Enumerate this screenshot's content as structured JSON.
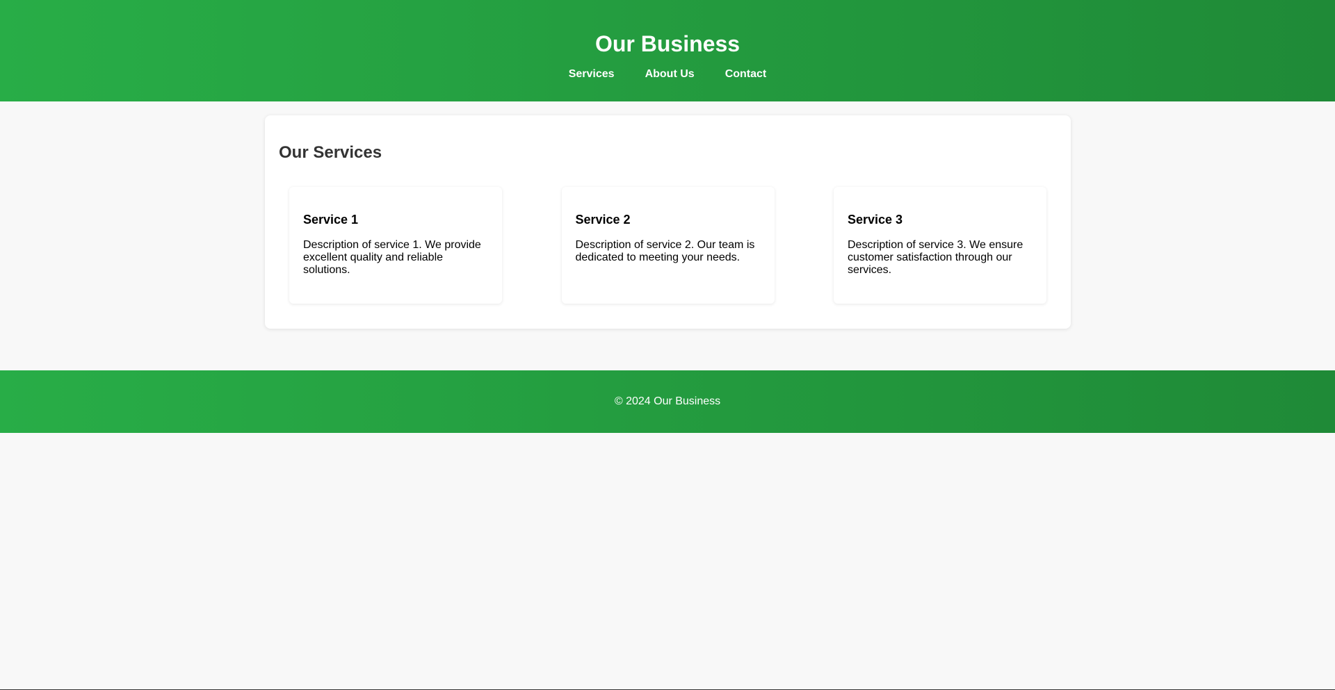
{
  "header": {
    "title": "Our Business",
    "nav": [
      {
        "label": "Services"
      },
      {
        "label": "About Us"
      },
      {
        "label": "Contact"
      }
    ]
  },
  "main": {
    "section_title": "Our Services",
    "services": [
      {
        "title": "Service 1",
        "description": "Description of service 1. We provide excellent quality and reliable solutions."
      },
      {
        "title": "Service 2",
        "description": "Description of service 2. Our team is dedicated to meeting your needs."
      },
      {
        "title": "Service 3",
        "description": "Description of service 3. We ensure customer satisfaction through our services."
      }
    ]
  },
  "footer": {
    "text": "© 2024 Our Business"
  },
  "colors": {
    "brand_green": "#28ad47",
    "brand_green_dark": "#1f8a37",
    "background": "#f8f8f8"
  }
}
